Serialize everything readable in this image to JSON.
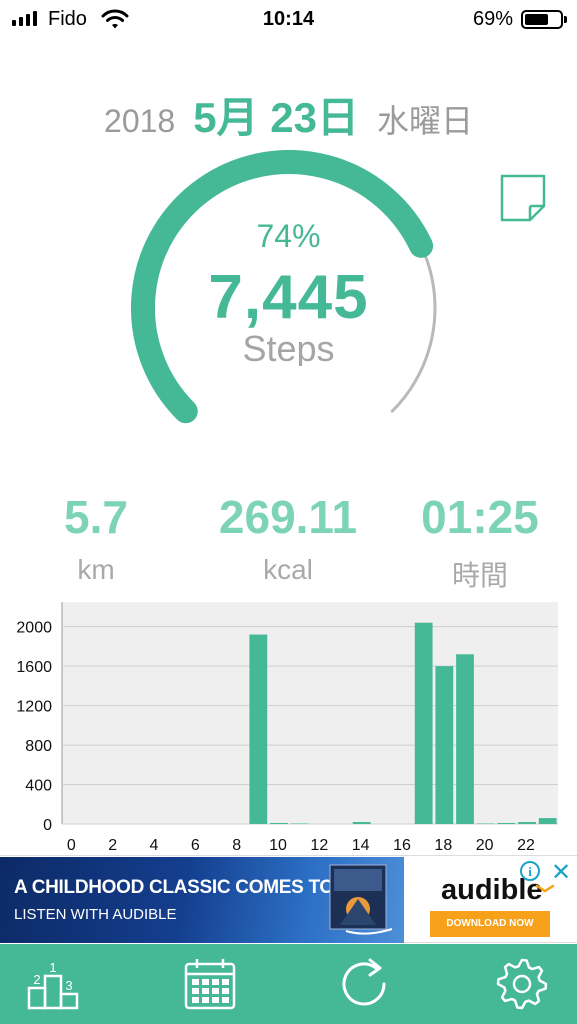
{
  "status_bar": {
    "carrier": "Fido",
    "time": "10:14",
    "battery": "69%",
    "battery_level": 0.69
  },
  "date": {
    "year": "2018",
    "month_day": "5月 23日",
    "weekday": "水曜日"
  },
  "progress": {
    "percent_label": "74%",
    "fraction": 0.74,
    "steps": "7,445",
    "steps_label": "Steps"
  },
  "stats": {
    "distance": {
      "value": "5.7",
      "unit": "km"
    },
    "calories": {
      "value": "269.11",
      "unit": "kcal"
    },
    "duration": {
      "value": "01:25",
      "unit": "時間"
    }
  },
  "chart_data": {
    "type": "bar",
    "x": [
      0,
      1,
      2,
      3,
      4,
      5,
      6,
      7,
      8,
      9,
      10,
      11,
      12,
      13,
      14,
      15,
      16,
      17,
      18,
      19,
      20,
      21,
      22,
      23
    ],
    "values": [
      0,
      0,
      0,
      0,
      0,
      0,
      0,
      0,
      0,
      1920,
      10,
      5,
      0,
      0,
      20,
      0,
      0,
      2040,
      1600,
      1720,
      5,
      10,
      20,
      60
    ],
    "xticks": [
      "0",
      "2",
      "4",
      "6",
      "8",
      "10",
      "12",
      "14",
      "16",
      "18",
      "20",
      "22"
    ],
    "yticks": [
      "0",
      "400",
      "800",
      "1200",
      "1600",
      "2000"
    ],
    "ylim": [
      0,
      2250
    ],
    "grid": true,
    "colors": {
      "bar": "#45b896",
      "plot_bg": "#efefef",
      "grid": "#cfcfcf"
    }
  },
  "ad": {
    "headline": "A CHILDHOOD CLASSIC COMES TO LIFE",
    "subline": "LISTEN WITH AUDIBLE",
    "brand": "audible",
    "cta": "DOWNLOAD NOW",
    "info": "i",
    "close": "✕"
  },
  "tabs": [
    {
      "name": "ranking-icon"
    },
    {
      "name": "calendar-icon"
    },
    {
      "name": "refresh-icon"
    },
    {
      "name": "settings-icon"
    }
  ],
  "colors": {
    "accent": "#45b896",
    "accent_light": "#7dd3b8",
    "muted": "#9a9a9a"
  }
}
